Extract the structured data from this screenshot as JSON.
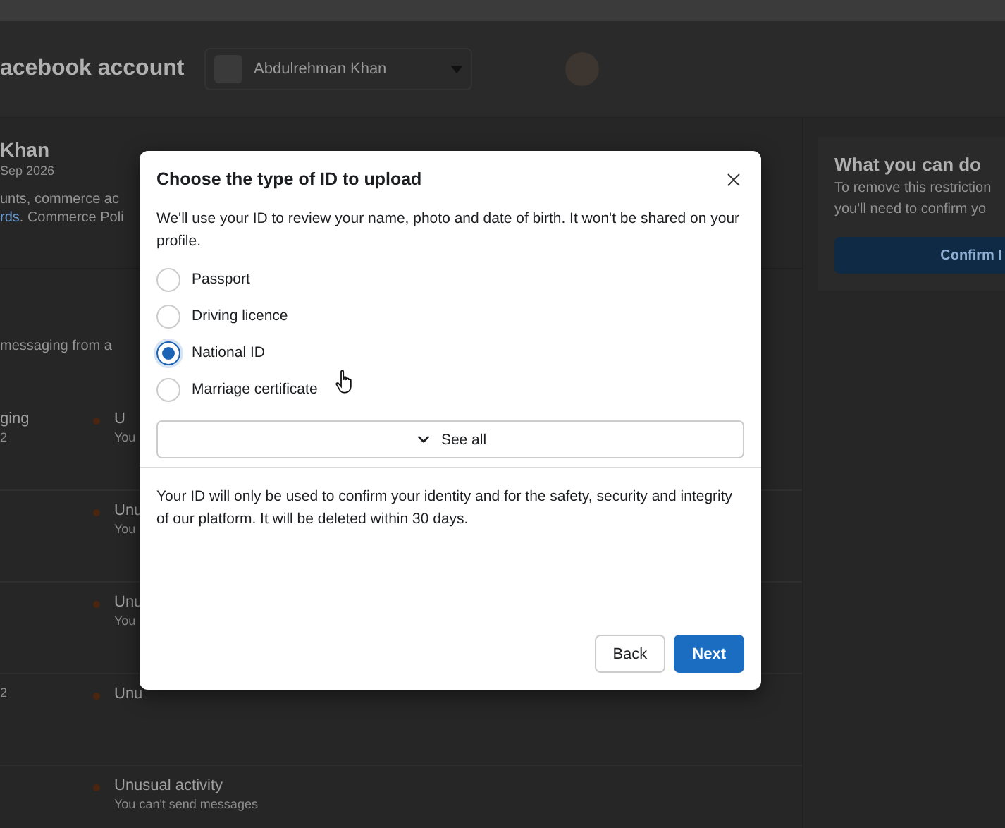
{
  "header": {
    "title": "acebook account",
    "account_selector": {
      "name": "Abdulrehman Khan"
    }
  },
  "profile": {
    "name": "Khan",
    "date": "Sep 2026",
    "line_1": "unts, commerce ac",
    "link": "rds",
    "line_2": ". Commerce Poli"
  },
  "notice": "messaging from a",
  "rows": [
    {
      "left_title": "ging",
      "left_sub": "2",
      "title": "U",
      "detail": "You"
    },
    {
      "title": "Unu",
      "detail": "You"
    },
    {
      "title": "Unu",
      "detail": "You"
    },
    {
      "left_sub": "2",
      "title": "Unu"
    },
    {
      "title": "Unusual activity",
      "detail": "You can't send messages"
    }
  ],
  "side_card": {
    "title": "What you can do",
    "text_1": "To remove this restriction",
    "text_2": "you'll need to confirm yo",
    "button": "Confirm I"
  },
  "dialog": {
    "title": "Choose the type of ID to upload",
    "description": "We'll use your ID to review your name, photo and date of birth. It won't be shared on your profile.",
    "options": [
      {
        "label": "Passport",
        "selected": false
      },
      {
        "label": "Driving licence",
        "selected": false
      },
      {
        "label": "National ID",
        "selected": true
      },
      {
        "label": "Marriage certificate",
        "selected": false
      }
    ],
    "see_all": "See all",
    "note": "Your ID will only be used to confirm your identity and for the safety, security and integrity of our platform. It will be deleted within 30 days.",
    "buttons": [
      {
        "label": "Back",
        "kind": "secondary"
      },
      {
        "label": "Next",
        "kind": "primary"
      }
    ]
  }
}
